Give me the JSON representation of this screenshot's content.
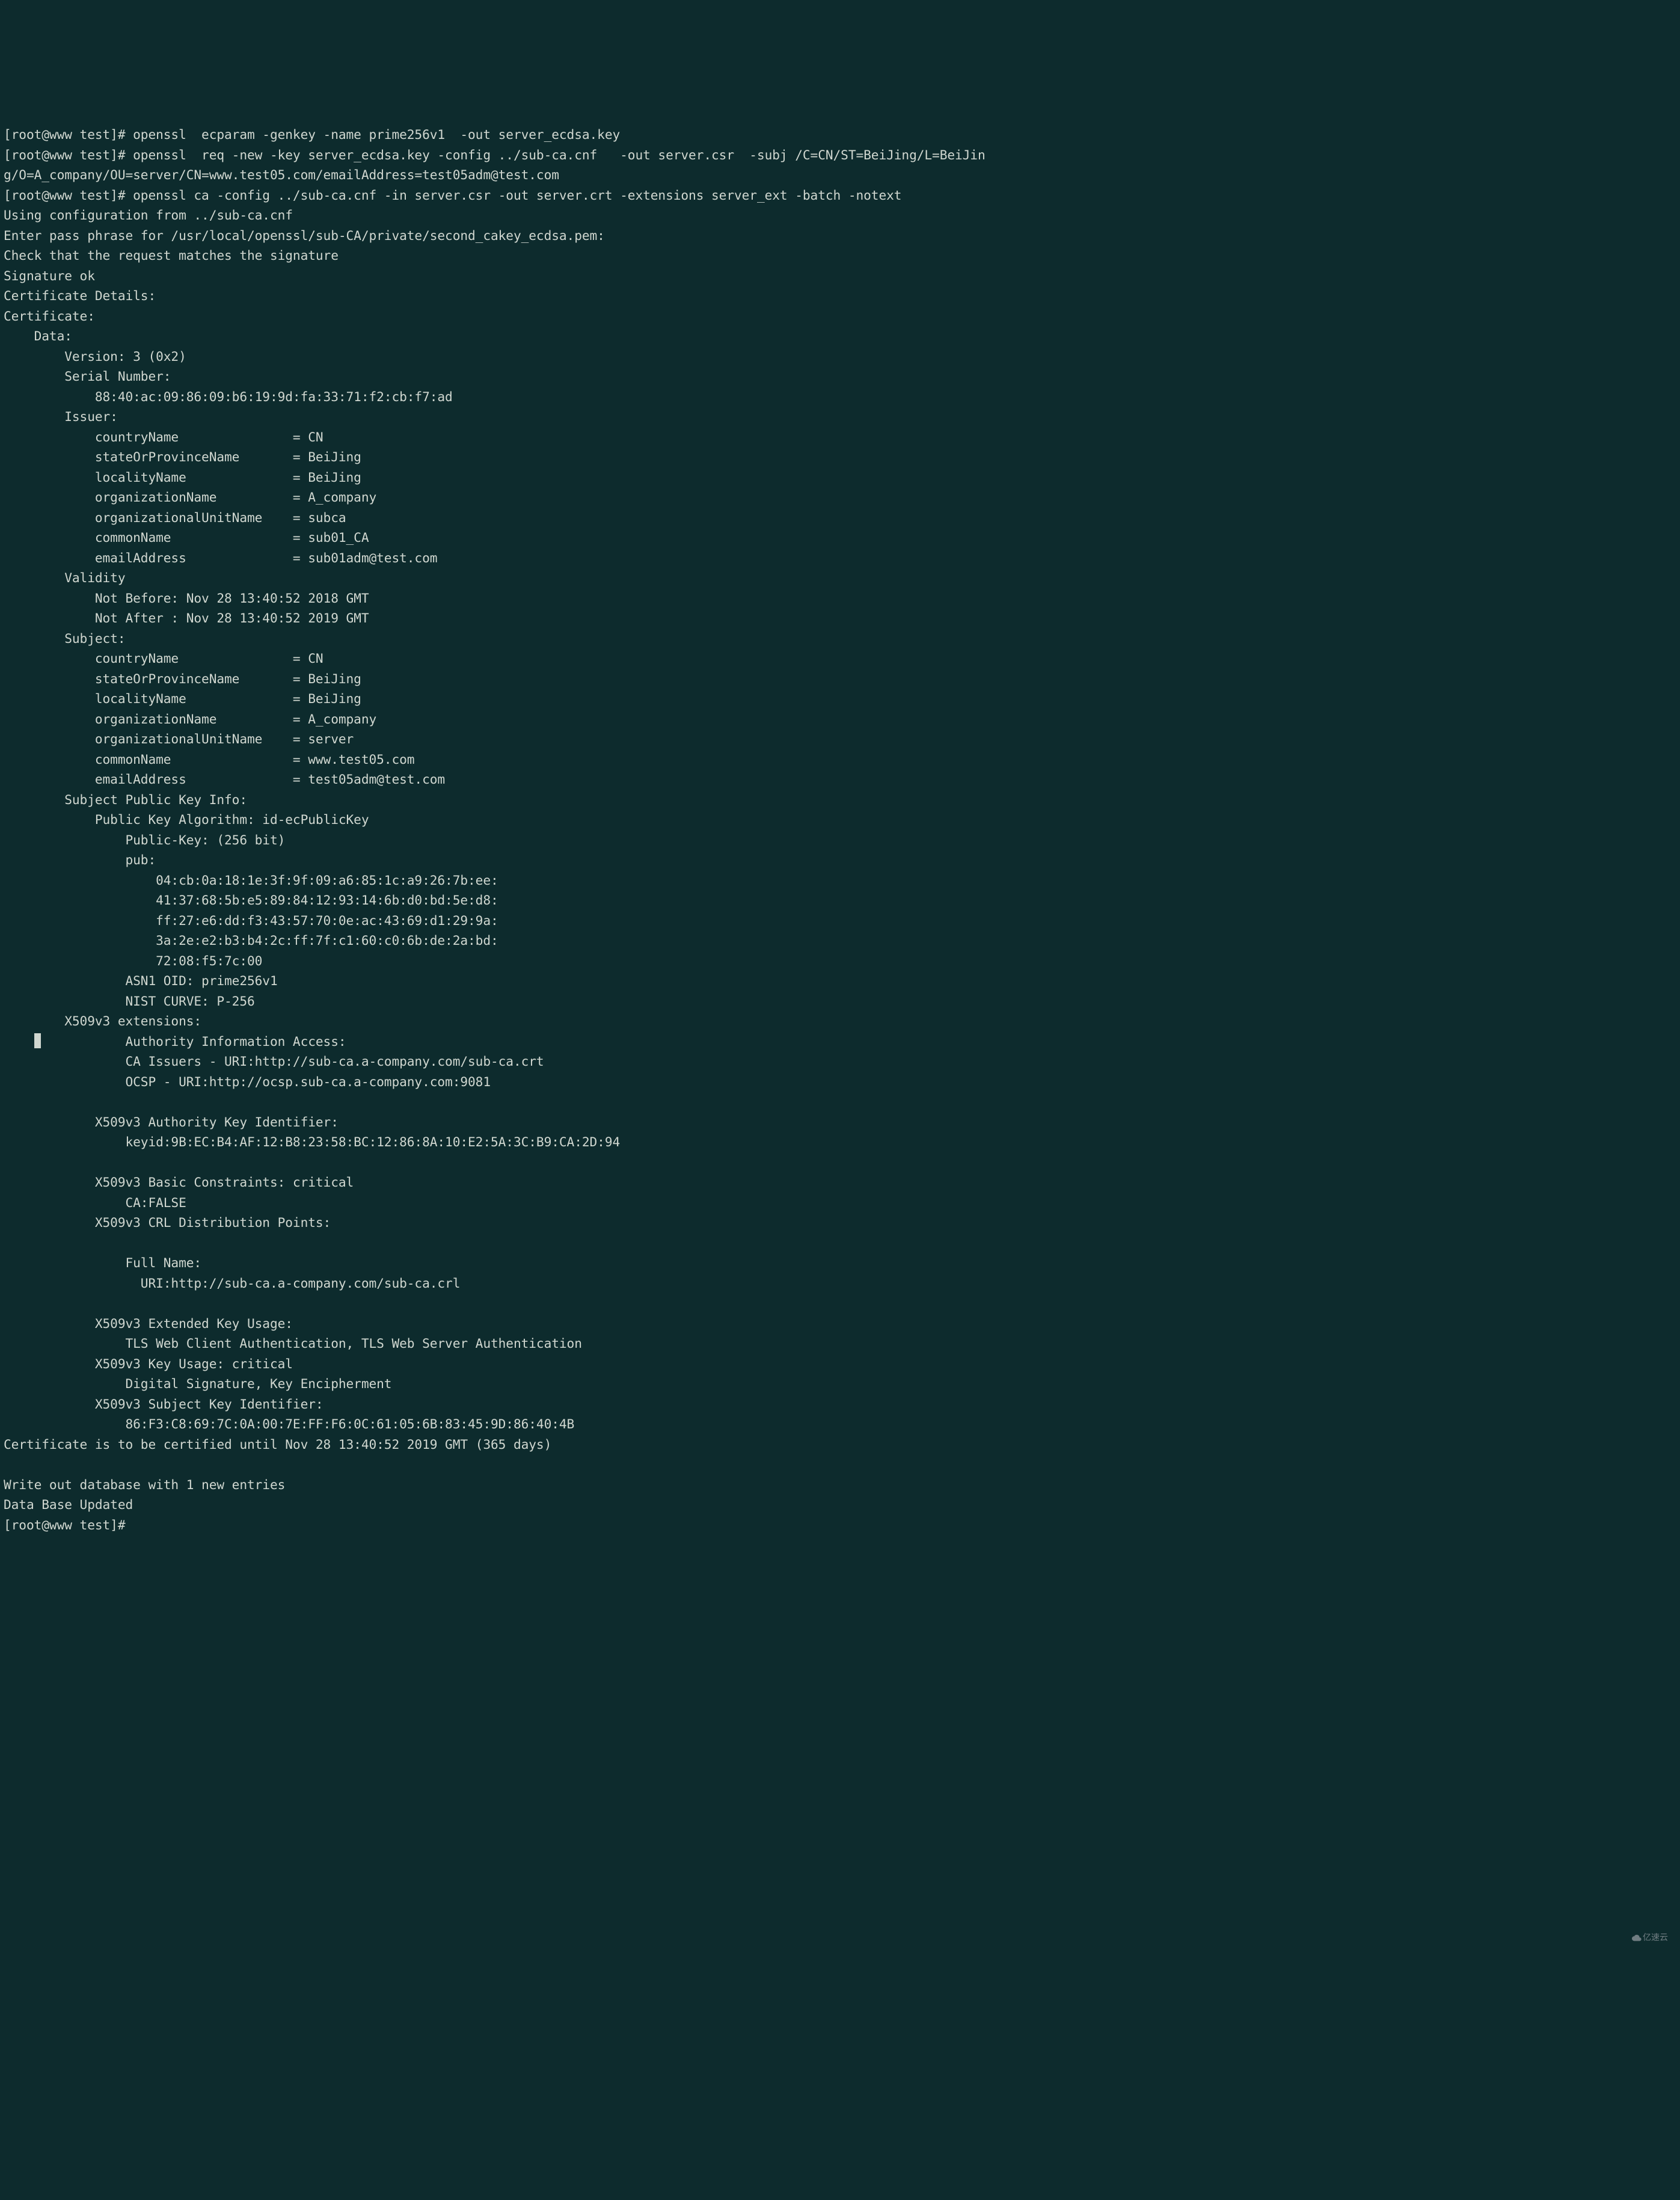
{
  "prompt": "[root@www test]# ",
  "cmd1": "openssl  ecparam -genkey -name prime256v1  -out server_ecdsa.key",
  "cmd2_line1": "openssl  req -new -key server_ecdsa.key -config ../sub-ca.cnf   -out server.csr  -subj /C=CN/ST=BeiJing/L=BeiJin",
  "cmd2_line2": "g/O=A_company/OU=server/CN=www.test05.com/emailAddress=test05adm@test.com",
  "cmd3": "openssl ca -config ../sub-ca.cnf -in server.csr -out server.crt -extensions server_ext -batch -notext",
  "out": {
    "using_config": "Using configuration from ../sub-ca.cnf",
    "passphrase": "Enter pass phrase for /usr/local/openssl/sub-CA/private/second_cakey_ecdsa.pem:",
    "check_sig": "Check that the request matches the signature",
    "sig_ok": "Signature ok",
    "cert_details": "Certificate Details:",
    "certificate": "Certificate:",
    "data": "    Data:",
    "version": "        Version: 3 (0x2)",
    "serial_label": "        Serial Number:",
    "serial_value": "            88:40:ac:09:86:09:b6:19:9d:fa:33:71:f2:cb:f7:ad",
    "issuer_label": "        Issuer:",
    "issuer_c": "            countryName               = CN",
    "issuer_st": "            stateOrProvinceName       = BeiJing",
    "issuer_l": "            localityName              = BeiJing",
    "issuer_o": "            organizationName          = A_company",
    "issuer_ou": "            organizationalUnitName    = subca",
    "issuer_cn": "            commonName                = sub01_CA",
    "issuer_em": "            emailAddress              = sub01adm@test.com",
    "validity": "        Validity",
    "not_before": "            Not Before: Nov 28 13:40:52 2018 GMT",
    "not_after": "            Not After : Nov 28 13:40:52 2019 GMT",
    "subject_label": "        Subject:",
    "subject_c": "            countryName               = CN",
    "subject_st": "            stateOrProvinceName       = BeiJing",
    "subject_l": "            localityName              = BeiJing",
    "subject_o": "            organizationName          = A_company",
    "subject_ou": "            organizationalUnitName    = server",
    "subject_cn": "            commonName                = www.test05.com",
    "subject_em": "            emailAddress              = test05adm@test.com",
    "spki": "        Subject Public Key Info:",
    "pkalg": "            Public Key Algorithm: id-ecPublicKey",
    "pkbits": "                Public-Key: (256 bit)",
    "pub_label": "                pub:",
    "pub1": "                    04:cb:0a:18:1e:3f:9f:09:a6:85:1c:a9:26:7b:ee:",
    "pub2": "                    41:37:68:5b:e5:89:84:12:93:14:6b:d0:bd:5e:d8:",
    "pub3": "                    ff:27:e6:dd:f3:43:57:70:0e:ac:43:69:d1:29:9a:",
    "pub4": "                    3a:2e:e2:b3:b4:2c:ff:7f:c1:60:c0:6b:de:2a:bd:",
    "pub5": "                    72:08:f5:7c:00",
    "asn1": "                ASN1 OID: prime256v1",
    "nist": "                NIST CURVE: P-256",
    "x509ext": "        X509v3 extensions:",
    "aia_label": "            Authority Information Access: ",
    "aia_ca": "                CA Issuers - URI:http://sub-ca.a-company.com/sub-ca.crt",
    "aia_ocsp": "                OCSP - URI:http://ocsp.sub-ca.a-company.com:9081",
    "aki_label": "            X509v3 Authority Key Identifier: ",
    "aki_value": "                keyid:9B:EC:B4:AF:12:B8:23:58:BC:12:86:8A:10:E2:5A:3C:B9:CA:2D:94",
    "bc_label": "            X509v3 Basic Constraints: critical",
    "bc_value": "                CA:FALSE",
    "crl_label": "            X509v3 CRL Distribution Points: ",
    "crl_full": "                Full Name:",
    "crl_uri": "                  URI:http://sub-ca.a-company.com/sub-ca.crl",
    "eku_label": "            X509v3 Extended Key Usage: ",
    "eku_value": "                TLS Web Client Authentication, TLS Web Server Authentication",
    "ku_label": "            X509v3 Key Usage: critical",
    "ku_value": "                Digital Signature, Key Encipherment",
    "ski_label": "            X509v3 Subject Key Identifier: ",
    "ski_value": "                86:F3:C8:69:7C:0A:00:7E:FF:F6:0C:61:05:6B:83:45:9D:86:40:4B",
    "until": "Certificate is to be certified until Nov 28 13:40:52 2019 GMT (365 days)",
    "writeout": "Write out database with 1 new entries",
    "dbupdated": "Data Base Updated"
  },
  "cursor_pad": "    ",
  "watermark": "亿速云"
}
